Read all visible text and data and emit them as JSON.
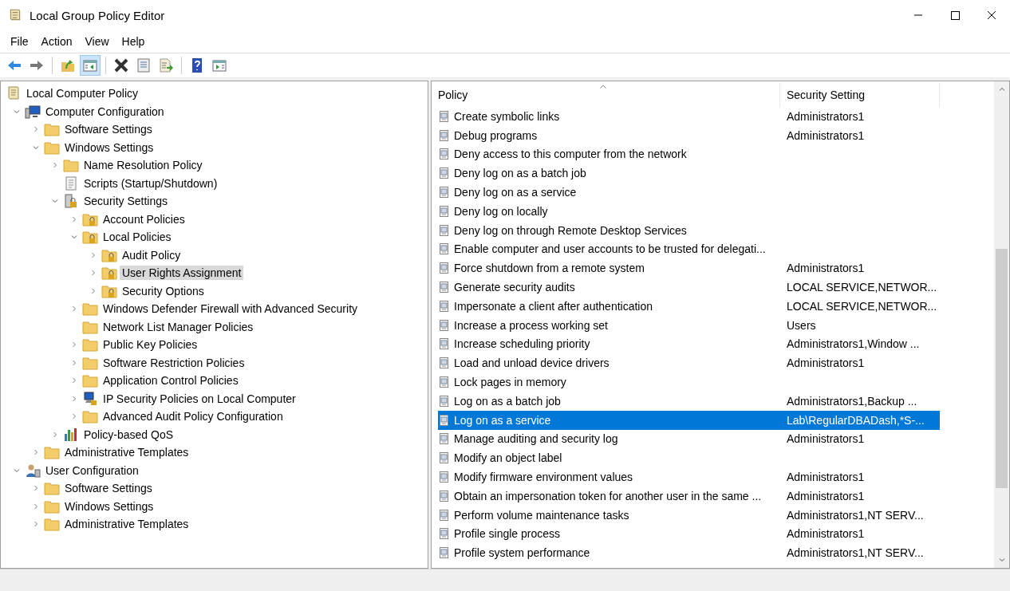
{
  "window": {
    "title": "Local Group Policy Editor"
  },
  "menu": [
    "File",
    "Action",
    "View",
    "Help"
  ],
  "toolbar": [
    {
      "kind": "back",
      "pressed": false
    },
    {
      "kind": "forward",
      "pressed": false
    },
    {
      "kind": "separator"
    },
    {
      "kind": "up",
      "pressed": false
    },
    {
      "kind": "tree",
      "pressed": true
    },
    {
      "kind": "separator"
    },
    {
      "kind": "delete",
      "pressed": false
    },
    {
      "kind": "properties",
      "pressed": false
    },
    {
      "kind": "export",
      "pressed": false
    },
    {
      "kind": "separator"
    },
    {
      "kind": "help",
      "pressed": false
    },
    {
      "kind": "actionpane",
      "pressed": false
    }
  ],
  "tree": [
    {
      "label": "Local Computer Policy",
      "kind": "scroll",
      "selected": false,
      "children": [
        {
          "label": "Computer Configuration",
          "kind": "computer",
          "expanded": true,
          "selected": false,
          "children": [
            {
              "label": "Software Settings",
              "kind": "folder",
              "expanded": false,
              "selected": false
            },
            {
              "label": "Windows Settings",
              "kind": "folder",
              "expanded": true,
              "selected": false,
              "children": [
                {
                  "label": "Name Resolution Policy",
                  "kind": "folder",
                  "expanded": false,
                  "selected": false
                },
                {
                  "label": "Scripts (Startup/Shutdown)",
                  "kind": "script",
                  "selected": false
                },
                {
                  "label": "Security Settings",
                  "kind": "security",
                  "expanded": true,
                  "selected": false,
                  "children": [
                    {
                      "label": "Account Policies",
                      "kind": "lockfolder",
                      "expanded": false,
                      "selected": false
                    },
                    {
                      "label": "Local Policies",
                      "kind": "lockfolder",
                      "expanded": true,
                      "selected": false,
                      "children": [
                        {
                          "label": "Audit Policy",
                          "kind": "lockfolder",
                          "expanded": false,
                          "selected": false
                        },
                        {
                          "label": "User Rights Assignment",
                          "kind": "lockfolder",
                          "expanded": false,
                          "selected": true
                        },
                        {
                          "label": "Security Options",
                          "kind": "lockfolder",
                          "expanded": false,
                          "selected": false
                        }
                      ]
                    },
                    {
                      "label": "Windows Defender Firewall with Advanced Security",
                      "kind": "folder",
                      "expanded": false,
                      "selected": false
                    },
                    {
                      "label": "Network List Manager Policies",
                      "kind": "folder",
                      "selected": false
                    },
                    {
                      "label": "Public Key Policies",
                      "kind": "folder",
                      "expanded": false,
                      "selected": false
                    },
                    {
                      "label": "Software Restriction Policies",
                      "kind": "folder",
                      "expanded": false,
                      "selected": false
                    },
                    {
                      "label": "Application Control Policies",
                      "kind": "folder",
                      "expanded": false,
                      "selected": false
                    },
                    {
                      "label": "IP Security Policies on Local Computer",
                      "kind": "ipsec",
                      "expanded": false,
                      "selected": false
                    },
                    {
                      "label": "Advanced Audit Policy Configuration",
                      "kind": "folder",
                      "expanded": false,
                      "selected": false
                    }
                  ]
                },
                {
                  "label": "Policy-based QoS",
                  "kind": "chart",
                  "expanded": false,
                  "selected": false
                }
              ]
            },
            {
              "label": "Administrative Templates",
              "kind": "folder",
              "expanded": false,
              "selected": false
            }
          ]
        },
        {
          "label": "User Configuration",
          "kind": "user",
          "expanded": true,
          "selected": false,
          "children": [
            {
              "label": "Software Settings",
              "kind": "folder",
              "expanded": false,
              "selected": false
            },
            {
              "label": "Windows Settings",
              "kind": "folder",
              "expanded": false,
              "selected": false
            },
            {
              "label": "Administrative Templates",
              "kind": "folder",
              "expanded": false,
              "selected": false
            }
          ]
        }
      ]
    }
  ],
  "table": {
    "columns": [
      "Policy",
      "Security Setting"
    ],
    "rows": [
      {
        "policy": "Create symbolic links",
        "setting": "Administrators1",
        "selected": false
      },
      {
        "policy": "Debug programs",
        "setting": "Administrators1",
        "selected": false
      },
      {
        "policy": "Deny access to this computer from the network",
        "selected": false
      },
      {
        "policy": "Deny log on as a batch job",
        "selected": false
      },
      {
        "policy": "Deny log on as a service",
        "selected": false
      },
      {
        "policy": "Deny log on locally",
        "selected": false
      },
      {
        "policy": "Deny log on through Remote Desktop Services",
        "selected": false
      },
      {
        "policy": "Enable computer and user accounts to be trusted for delegati...",
        "selected": false
      },
      {
        "policy": "Force shutdown from a remote system",
        "setting": "Administrators1",
        "selected": false
      },
      {
        "policy": "Generate security audits",
        "setting": "LOCAL SERVICE,NETWOR...",
        "selected": false
      },
      {
        "policy": "Impersonate a client after authentication",
        "setting": "LOCAL SERVICE,NETWOR...",
        "selected": false
      },
      {
        "policy": "Increase a process working set",
        "setting": "Users",
        "selected": false
      },
      {
        "policy": "Increase scheduling priority",
        "setting": "Administrators1,Window ...",
        "selected": false
      },
      {
        "policy": "Load and unload device drivers",
        "setting": "Administrators1",
        "selected": false
      },
      {
        "policy": "Lock pages in memory",
        "selected": false
      },
      {
        "policy": "Log on as a batch job",
        "setting": "Administrators1,Backup ...",
        "selected": false
      },
      {
        "policy": "Log on as a service",
        "setting": "Lab\\RegularDBADash,*S-...",
        "selected": true
      },
      {
        "policy": "Manage auditing and security log",
        "setting": "Administrators1",
        "selected": false
      },
      {
        "policy": "Modify an object label",
        "selected": false
      },
      {
        "policy": "Modify firmware environment values",
        "setting": "Administrators1",
        "selected": false
      },
      {
        "policy": "Obtain an impersonation token for another user in the same ...",
        "setting": "Administrators1",
        "selected": false
      },
      {
        "policy": "Perform volume maintenance tasks",
        "setting": "Administrators1,NT SERV...",
        "selected": false
      },
      {
        "policy": "Profile single process",
        "setting": "Administrators1",
        "selected": false
      },
      {
        "policy": "Profile system performance",
        "setting": "Administrators1,NT SERV...",
        "selected": false
      }
    ]
  }
}
